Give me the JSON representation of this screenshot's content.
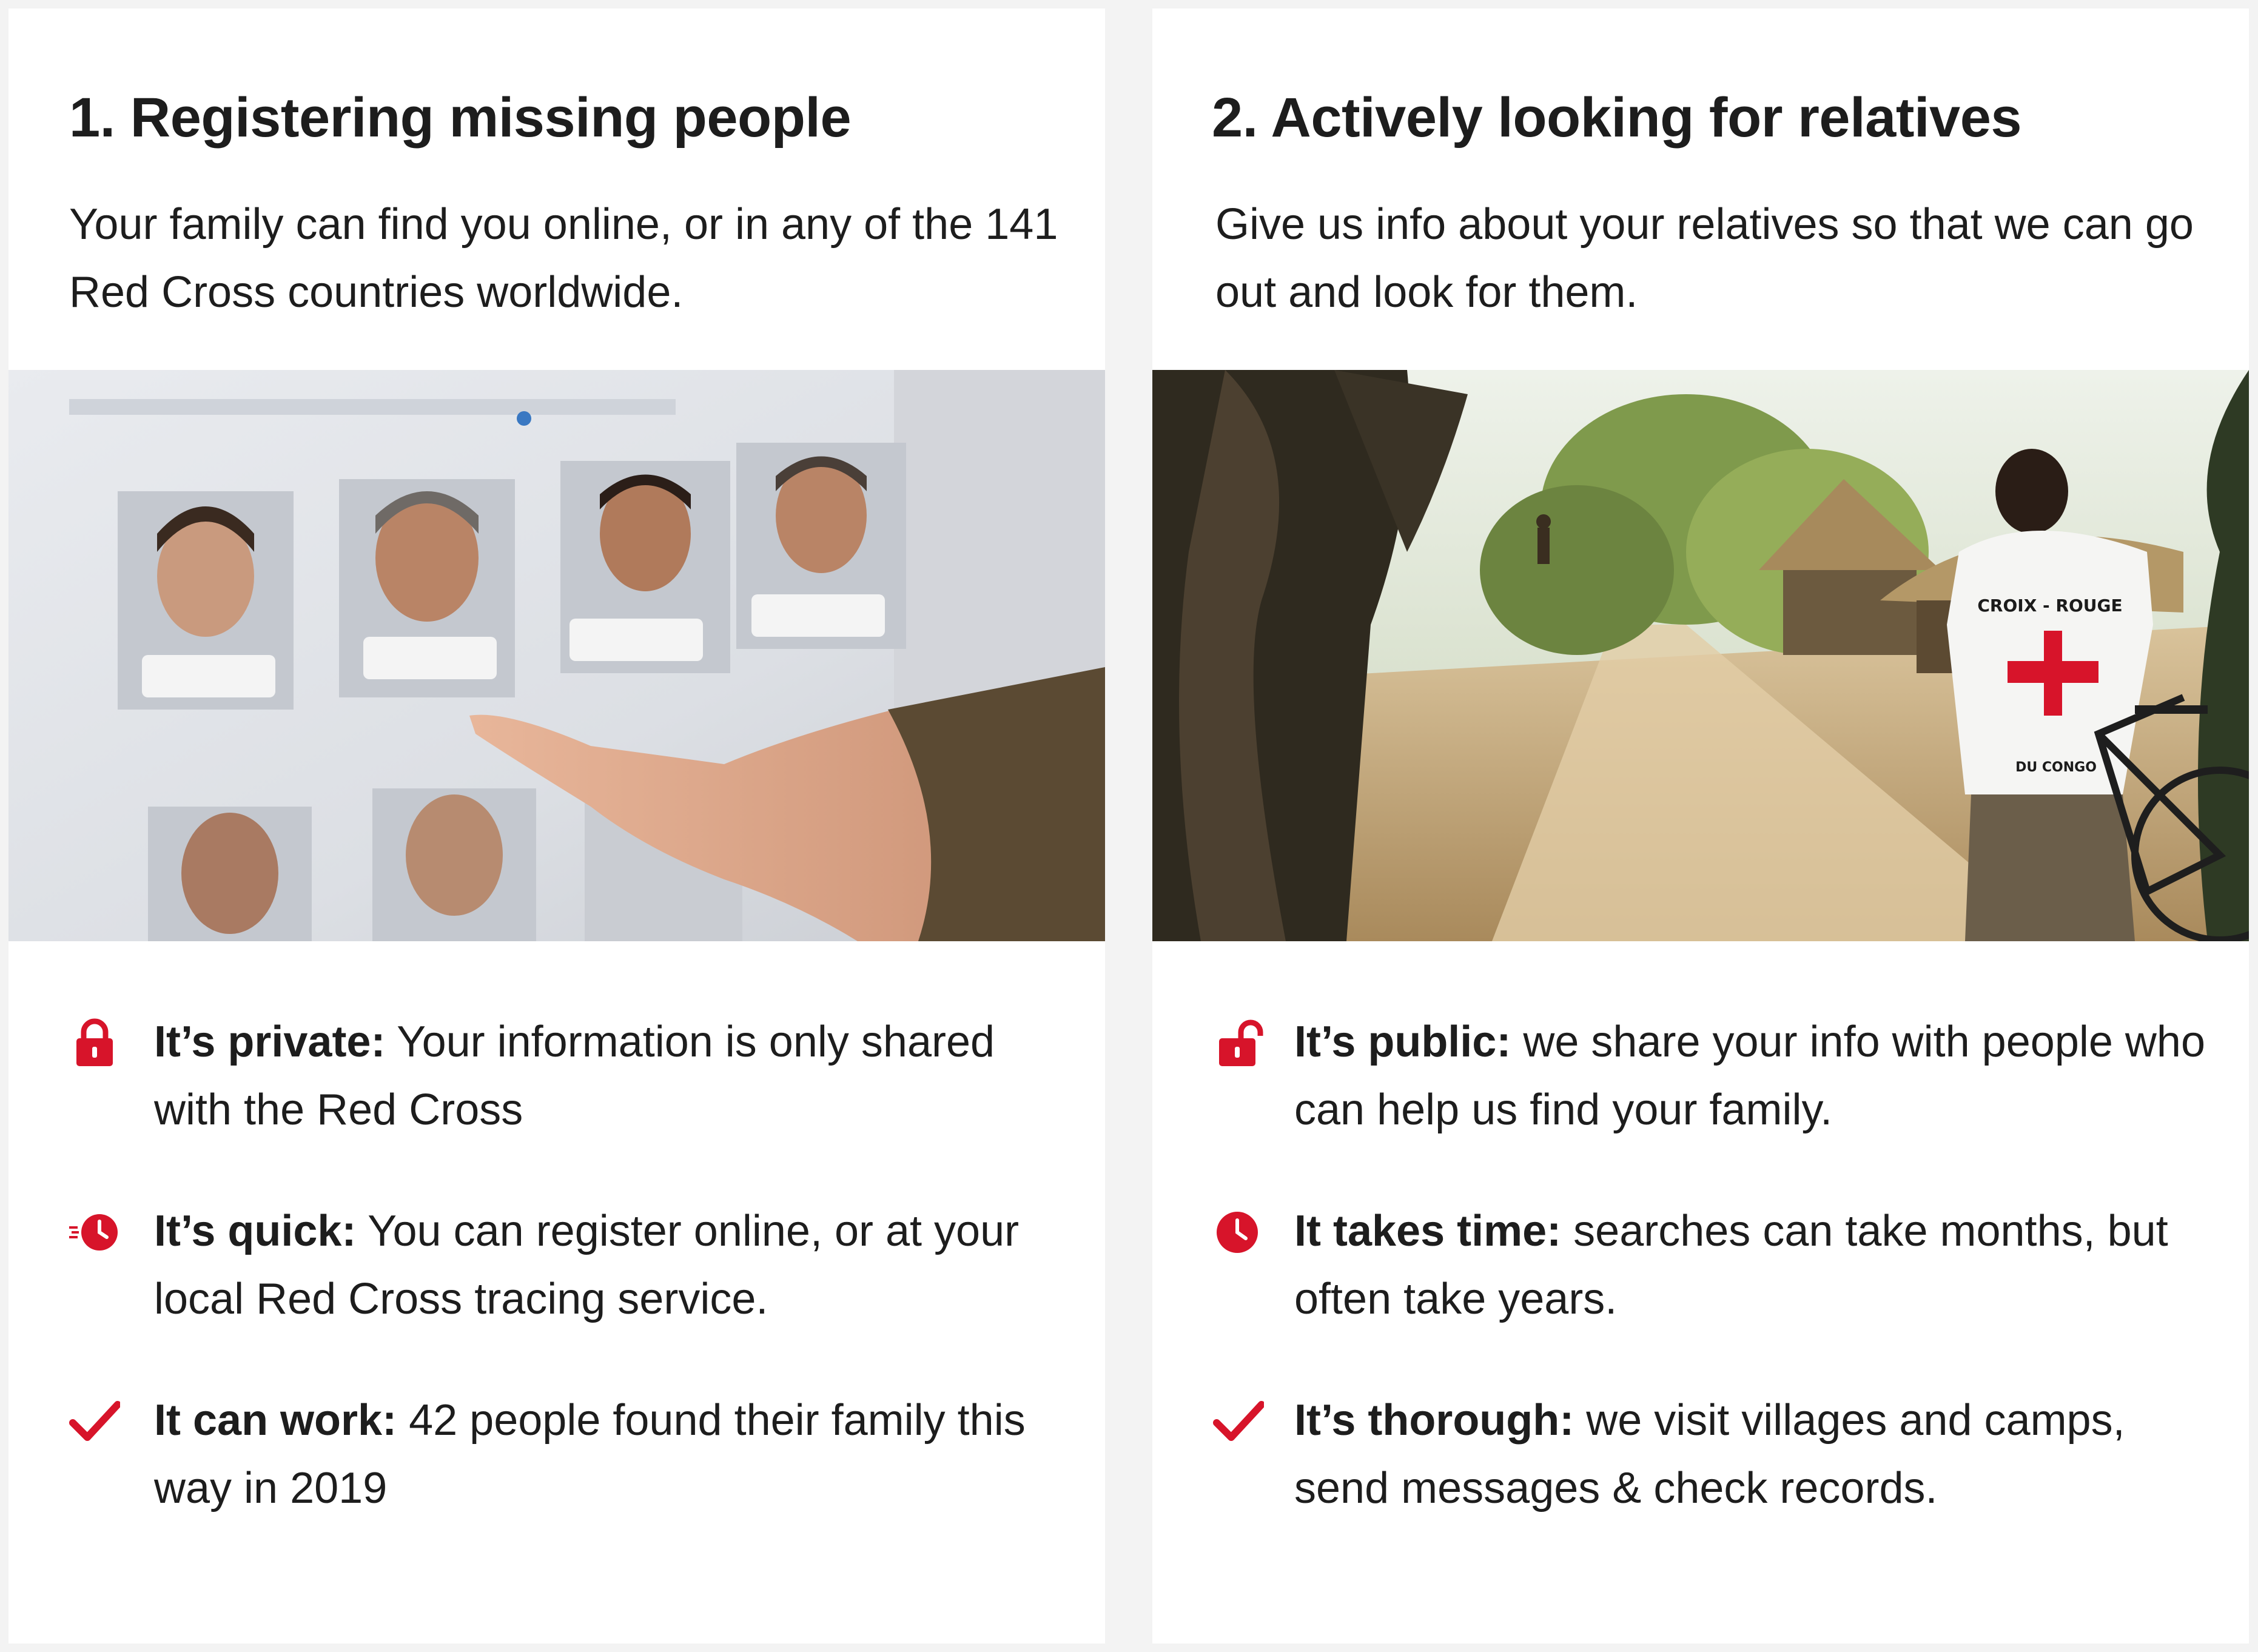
{
  "accent_color": "#d7142a",
  "panels": [
    {
      "title": "1. Registering missing people",
      "intro": "Your family can find you online, or in any of the 141 Red Cross countries worldwide.",
      "photo": "photo-finger-pointing-at-missing-person-profiles-on-screen",
      "features": [
        {
          "icon": "lock-icon",
          "label": "It’s private:",
          "text": " Your information is only shared with the Red Cross"
        },
        {
          "icon": "fast-clock-icon",
          "label": "It’s quick:",
          "text": " You can register online, or at your local Red Cross tracing service."
        },
        {
          "icon": "checkmark-icon",
          "label": "It can work:",
          "text": " 42 people found their family this way in 2019"
        }
      ]
    },
    {
      "title": "2. Actively looking for relatives",
      "intro": "Give us info about your relatives so that we can go out and look for them.",
      "photo": "photo-red-cross-volunteer-with-bicycle-in-village",
      "photo_text": {
        "vest_top": "CROIX - ROUGE",
        "vest_bottom": "DU CONGO"
      },
      "features": [
        {
          "icon": "unlocked-lock-icon",
          "label": "It’s public:",
          "text": " we share your info with people who can help us find your family."
        },
        {
          "icon": "clock-icon",
          "label": "It takes time:",
          "text": " searches can take months, but often take years."
        },
        {
          "icon": "checkmark-icon",
          "label": "It’s thorough:",
          "text": " we visit villages and camps, send messages & check records."
        }
      ]
    }
  ]
}
